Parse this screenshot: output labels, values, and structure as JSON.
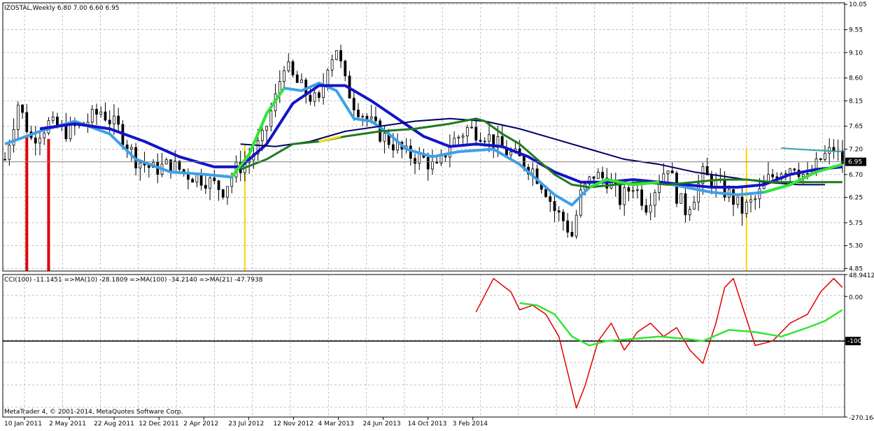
{
  "header": {
    "symbol_line": "IZOSTAL,Weekly  6.80 7.00 6.60 6.95",
    "indicator_line": "CCI(100) -11.1451  =>MA(10) -28.1809  =>MA(100) -34.2140  =>MA(21) -47.7938"
  },
  "footer": {
    "copyright": "MetaTrader 4, © 2001-2014, MetaQuotes Software Corp."
  },
  "colors": {
    "background": "#ffffff",
    "grid": "#c0c0c0",
    "candle": "#000000",
    "ma_fast": "#3ea0e8",
    "ma_slow": "#1414c8",
    "ma_dark": "#000066",
    "ma_green": "#1e7a1e",
    "trend_bright": "#33e633",
    "segment_yellow": "#ffe100",
    "segment_red": "#e00000",
    "cyan_line": "#36a0a8",
    "cci": "#e00000",
    "cci_ma": "#33e633",
    "vbar_red": "#e00000",
    "vbar_yellow": "#ffd400",
    "level_line": "#000000"
  },
  "chart_data": [
    {
      "type": "candlestick",
      "title": "IZOSTAL,Weekly",
      "ohlc_last": {
        "open": 6.8,
        "high": 7.0,
        "low": 6.6,
        "close": 6.95
      },
      "timeframe": "Weekly",
      "x_labels": [
        "10 Jan 2011",
        "2 May 2011",
        "22 Aug 2011",
        "12 Dec 2011",
        "2 Apr 2012",
        "23 Jul 2012",
        "12 Nov 2012",
        "4 Mar 2013",
        "24 Jun 2013",
        "14 Oct 2013",
        "3 Feb 2014"
      ],
      "y_ticks": [
        10.05,
        9.55,
        9.1,
        8.6,
        8.15,
        7.65,
        7.2,
        6.7,
        6.25,
        5.75,
        5.3,
        4.85
      ],
      "y_tick_labels": [
        "10.05",
        "9.55",
        "9.10",
        "8.60",
        "8.15",
        "7.65",
        "7.20",
        "6.70",
        "6.25",
        "5.75",
        "5.30",
        "4.85"
      ],
      "ylim": [
        4.8,
        10.08
      ],
      "current_price": 6.95,
      "current_price_label": "6.95",
      "grid": true,
      "close_anchors": [
        [
          0,
          7.0
        ],
        [
          3,
          8.1
        ],
        [
          6,
          7.4
        ],
        [
          10,
          7.7
        ],
        [
          14,
          7.55
        ],
        [
          18,
          7.7
        ],
        [
          22,
          7.95
        ],
        [
          26,
          7.6
        ],
        [
          30,
          7.0
        ],
        [
          34,
          6.8
        ],
        [
          38,
          6.9
        ],
        [
          42,
          6.7
        ],
        [
          46,
          6.6
        ],
        [
          50,
          6.4
        ],
        [
          53,
          6.8
        ],
        [
          56,
          7.0
        ],
        [
          59,
          7.4
        ],
        [
          62,
          8.2
        ],
        [
          64,
          8.9
        ],
        [
          66,
          8.6
        ],
        [
          69,
          8.3
        ],
        [
          72,
          8.1
        ],
        [
          74,
          8.9
        ],
        [
          76,
          9.2
        ],
        [
          78,
          8.5
        ],
        [
          80,
          8.1
        ],
        [
          83,
          7.8
        ],
        [
          86,
          7.5
        ],
        [
          89,
          7.3
        ],
        [
          92,
          7.1
        ],
        [
          96,
          7.0
        ],
        [
          99,
          6.8
        ],
        [
          102,
          7.3
        ],
        [
          106,
          7.6
        ],
        [
          110,
          7.5
        ],
        [
          114,
          7.2
        ],
        [
          118,
          7.0
        ],
        [
          121,
          6.8
        ],
        [
          124,
          6.4
        ],
        [
          126,
          6.0
        ],
        [
          128,
          5.8
        ],
        [
          130,
          5.5
        ],
        [
          132,
          6.3
        ],
        [
          135,
          6.7
        ],
        [
          138,
          6.6
        ],
        [
          141,
          6.2
        ],
        [
          144,
          6.5
        ],
        [
          147,
          6.1
        ],
        [
          150,
          6.6
        ],
        [
          152,
          6.9
        ],
        [
          154,
          6.3
        ],
        [
          156,
          6.0
        ],
        [
          158,
          6.3
        ],
        [
          160,
          6.7
        ],
        [
          163,
          6.5
        ],
        [
          166,
          6.3
        ],
        [
          169,
          6.0
        ],
        [
          172,
          6.2
        ],
        [
          175,
          6.6
        ],
        [
          178,
          6.8
        ],
        [
          181,
          6.9
        ],
        [
          184,
          6.6
        ],
        [
          187,
          7.0
        ],
        [
          190,
          7.2
        ],
        [
          192,
          6.95
        ]
      ],
      "series": [
        {
          "name": "",
          "color": "#3ea0e8",
          "values": [
            [
              0,
              7.3
            ],
            [
              8,
              7.55
            ],
            [
              16,
              7.75
            ],
            [
              24,
              7.5
            ],
            [
              30,
              7.0
            ],
            [
              38,
              6.75
            ],
            [
              46,
              6.7
            ],
            [
              52,
              6.65
            ],
            [
              56,
              7.1
            ],
            [
              60,
              7.9
            ],
            [
              64,
              8.4
            ],
            [
              68,
              8.35
            ],
            [
              72,
              8.5
            ],
            [
              76,
              8.35
            ],
            [
              80,
              7.8
            ],
            [
              84,
              7.75
            ],
            [
              88,
              7.5
            ],
            [
              92,
              7.2
            ],
            [
              98,
              7.05
            ],
            [
              104,
              7.15
            ],
            [
              112,
              7.2
            ],
            [
              118,
              6.9
            ],
            [
              122,
              6.6
            ],
            [
              126,
              6.3
            ],
            [
              130,
              6.1
            ],
            [
              134,
              6.45
            ],
            [
              138,
              6.6
            ],
            [
              144,
              6.5
            ],
            [
              150,
              6.55
            ],
            [
              156,
              6.45
            ],
            [
              162,
              6.35
            ],
            [
              168,
              6.3
            ],
            [
              174,
              6.35
            ],
            [
              180,
              6.5
            ],
            [
              186,
              6.75
            ],
            [
              192,
              6.9
            ]
          ]
        },
        {
          "name": "",
          "color": "#1414c8",
          "values": [
            [
              8,
              7.6
            ],
            [
              16,
              7.7
            ],
            [
              24,
              7.6
            ],
            [
              32,
              7.35
            ],
            [
              40,
              7.05
            ],
            [
              48,
              6.85
            ],
            [
              54,
              6.85
            ],
            [
              60,
              7.3
            ],
            [
              66,
              8.1
            ],
            [
              72,
              8.45
            ],
            [
              78,
              8.45
            ],
            [
              84,
              8.15
            ],
            [
              90,
              7.8
            ],
            [
              96,
              7.45
            ],
            [
              102,
              7.25
            ],
            [
              108,
              7.3
            ],
            [
              114,
              7.25
            ],
            [
              120,
              7.05
            ],
            [
              126,
              6.75
            ],
            [
              132,
              6.55
            ],
            [
              138,
              6.55
            ],
            [
              144,
              6.6
            ],
            [
              150,
              6.55
            ],
            [
              156,
              6.5
            ],
            [
              162,
              6.45
            ],
            [
              168,
              6.45
            ],
            [
              174,
              6.5
            ],
            [
              180,
              6.7
            ],
            [
              186,
              6.8
            ],
            [
              192,
              6.85
            ]
          ]
        },
        {
          "name": "",
          "color": "#000066",
          "values": [
            [
              54,
              7.3
            ],
            [
              62,
              7.25
            ],
            [
              70,
              7.35
            ],
            [
              78,
              7.55
            ],
            [
              86,
              7.65
            ],
            [
              94,
              7.75
            ],
            [
              102,
              7.8
            ],
            [
              110,
              7.75
            ],
            [
              118,
              7.6
            ],
            [
              126,
              7.4
            ],
            [
              134,
              7.2
            ],
            [
              142,
              7.0
            ],
            [
              150,
              6.9
            ],
            [
              158,
              6.75
            ],
            [
              166,
              6.65
            ],
            [
              174,
              6.55
            ],
            [
              182,
              6.5
            ],
            [
              188,
              6.5
            ]
          ]
        },
        {
          "name": "",
          "color": "#1e7a1e",
          "values": [
            [
              54,
              6.8
            ],
            [
              60,
              7.0
            ],
            [
              66,
              7.3
            ],
            [
              72,
              7.35
            ],
            [
              78,
              7.45
            ],
            [
              86,
              7.55
            ],
            [
              94,
              7.6
            ],
            [
              102,
              7.7
            ],
            [
              108,
              7.8
            ],
            [
              110,
              7.75
            ],
            [
              114,
              7.5
            ],
            [
              118,
              7.3
            ],
            [
              122,
              7.0
            ],
            [
              126,
              6.7
            ],
            [
              130,
              6.5
            ],
            [
              134,
              6.45
            ],
            [
              140,
              6.5
            ],
            [
              146,
              6.55
            ],
            [
              152,
              6.5
            ],
            [
              158,
              6.55
            ],
            [
              164,
              6.6
            ],
            [
              170,
              6.6
            ],
            [
              176,
              6.55
            ],
            [
              182,
              6.55
            ],
            [
              188,
              6.55
            ],
            [
              192,
              6.55
            ]
          ]
        },
        {
          "name": "",
          "color": "#36a0a8",
          "values": [
            [
              178,
              7.22
            ],
            [
              185,
              7.18
            ],
            [
              192,
              7.15
            ]
          ]
        }
      ],
      "vertical_markers": [
        {
          "bar": 5,
          "value_top": 7.45,
          "color": "#e00000"
        },
        {
          "bar": 10,
          "value_top": 7.4,
          "color": "#e00000"
        },
        {
          "bar": 55,
          "value_top": 7.3,
          "color": "#ffd400"
        },
        {
          "bar": 170,
          "value_top": 7.22,
          "color": "#ffd400"
        }
      ]
    },
    {
      "type": "line",
      "title": "CCI(100) -11.1451",
      "ylim": [
        -270.164,
        48.9412
      ],
      "y_ticks": [
        48.9412,
        0.0,
        -100,
        -270.164
      ],
      "y_tick_labels": [
        "48.9412",
        "0.00",
        "-100",
        "-270.164"
      ],
      "level": -100,
      "series": [
        {
          "name": "",
          "color": "#e00000",
          "values": [
            [
              108,
              -35
            ],
            [
              112,
              40
            ],
            [
              116,
              10
            ],
            [
              118,
              -30
            ],
            [
              121,
              -20
            ],
            [
              124,
              -40
            ],
            [
              127,
              -90
            ],
            [
              129,
              -170
            ],
            [
              131,
              -250
            ],
            [
              133,
              -200
            ],
            [
              136,
              -100
            ],
            [
              139,
              -60
            ],
            [
              142,
              -120
            ],
            [
              145,
              -80
            ],
            [
              148,
              -60
            ],
            [
              151,
              -90
            ],
            [
              154,
              -70
            ],
            [
              157,
              -120
            ],
            [
              160,
              -150
            ],
            [
              163,
              -60
            ],
            [
              165,
              20
            ],
            [
              167,
              40
            ],
            [
              169,
              -20
            ],
            [
              172,
              -110
            ],
            [
              176,
              -100
            ],
            [
              180,
              -60
            ],
            [
              184,
              -40
            ],
            [
              187,
              10
            ],
            [
              190,
              40
            ],
            [
              192,
              20
            ]
          ]
        },
        {
          "name": "",
          "color": "#33e633",
          "values": [
            [
              118,
              -15
            ],
            [
              122,
              -20
            ],
            [
              126,
              -40
            ],
            [
              130,
              -90
            ],
            [
              134,
              -110
            ],
            [
              138,
              -100
            ],
            [
              144,
              -95
            ],
            [
              150,
              -90
            ],
            [
              156,
              -95
            ],
            [
              160,
              -100
            ],
            [
              166,
              -75
            ],
            [
              172,
              -80
            ],
            [
              178,
              -90
            ],
            [
              184,
              -70
            ],
            [
              188,
              -55
            ],
            [
              192,
              -30
            ]
          ]
        }
      ]
    }
  ]
}
